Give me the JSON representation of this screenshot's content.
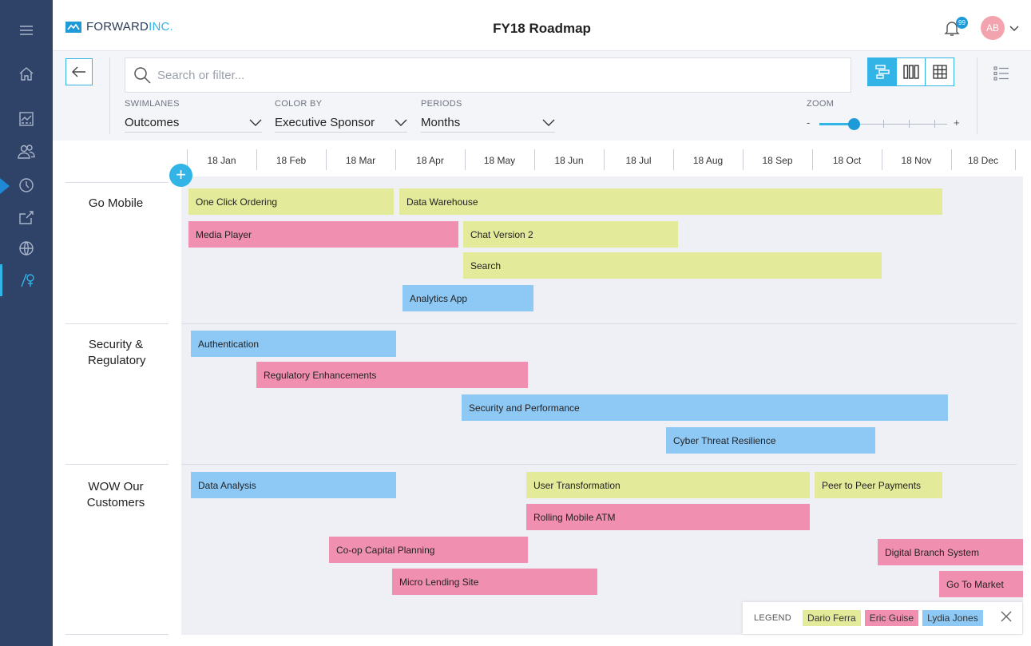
{
  "header": {
    "logo_main": "FORWARD",
    "logo_sub": "INC.",
    "title": "FY18 Roadmap",
    "notification_count": "99",
    "avatar_initials": "AB"
  },
  "toolbar": {
    "search_placeholder": "Search or filter...",
    "swimlanes": {
      "label": "SWIMLANES",
      "value": "Outcomes"
    },
    "color_by": {
      "label": "COLOR BY",
      "value": "Executive Sponsor"
    },
    "periods": {
      "label": "PERIODS",
      "value": "Months"
    },
    "zoom": {
      "label": "ZOOM",
      "minus": "-",
      "plus": "+",
      "level": 0.25
    },
    "active_view": "timeline"
  },
  "sidebar": {
    "items": [
      "menu-icon",
      "home-icon",
      "dashboard-icon",
      "people-icon",
      "clock-icon",
      "export-icon",
      "globe-icon",
      "roadmap-icon"
    ],
    "active": "roadmap-icon"
  },
  "timeline": {
    "months": [
      "18 Jan",
      "18 Feb",
      "18 Mar",
      "18 Apr",
      "18 May",
      "18 Jun",
      "18 Jul",
      "18 Aug",
      "18 Sep",
      "18 Oct",
      "18 Nov",
      "18 Dec"
    ]
  },
  "swimlanes": [
    {
      "label": "Go Mobile",
      "bars": [
        {
          "label": "One Click Ordering",
          "sponsor": "Dario Ferra"
        },
        {
          "label": "Data Warehouse",
          "sponsor": "Dario Ferra"
        },
        {
          "label": "Media Player",
          "sponsor": "Eric Guise"
        },
        {
          "label": "Chat Version 2",
          "sponsor": "Dario Ferra"
        },
        {
          "label": "Search",
          "sponsor": "Dario Ferra"
        },
        {
          "label": "Analytics App",
          "sponsor": "Lydia Jones"
        }
      ]
    },
    {
      "label": "Security & Regulatory",
      "bars": [
        {
          "label": "Authentication",
          "sponsor": "Lydia Jones"
        },
        {
          "label": "Regulatory Enhancements",
          "sponsor": "Eric Guise"
        },
        {
          "label": "Security and Performance",
          "sponsor": "Lydia Jones"
        },
        {
          "label": "Cyber Threat Resilience",
          "sponsor": "Lydia Jones"
        }
      ]
    },
    {
      "label": "WOW Our Customers",
      "bars": [
        {
          "label": "Data Analysis",
          "sponsor": "Lydia Jones"
        },
        {
          "label": "User Transformation",
          "sponsor": "Dario Ferra"
        },
        {
          "label": "Peer to Peer Payments",
          "sponsor": "Dario Ferra"
        },
        {
          "label": "Rolling Mobile ATM",
          "sponsor": "Eric Guise"
        },
        {
          "label": "Co-op Capital Planning",
          "sponsor": "Eric Guise"
        },
        {
          "label": "Digital Branch System",
          "sponsor": "Eric Guise"
        },
        {
          "label": "Micro Lending Site",
          "sponsor": "Eric Guise"
        },
        {
          "label": "Go To Market",
          "sponsor": "Eric Guise"
        }
      ]
    }
  ],
  "legend": {
    "title": "LEGEND",
    "items": [
      {
        "label": "Dario Ferra",
        "color": "#e3ea9a"
      },
      {
        "label": "Eric Guise",
        "color": "#f18fb0"
      },
      {
        "label": "Lydia Jones",
        "color": "#8ec9f6"
      }
    ]
  },
  "colors": {
    "sidebar": "#2f4268",
    "accent": "#32b4e6",
    "grid_background": "#eef0f5"
  }
}
